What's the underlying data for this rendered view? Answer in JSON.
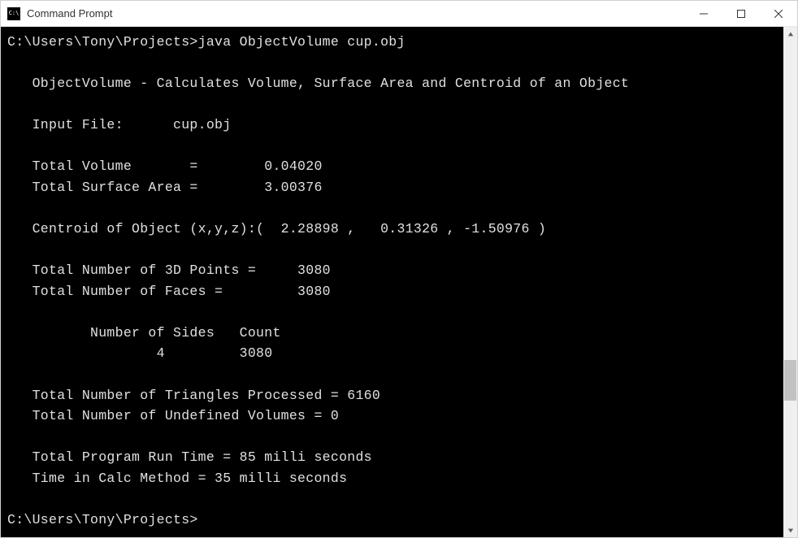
{
  "window": {
    "title": "Command Prompt"
  },
  "console": {
    "prompt1": "C:\\Users\\Tony\\Projects>java ObjectVolume cup.obj",
    "blank": "",
    "title_line": "   ObjectVolume - Calculates Volume, Surface Area and Centroid of an Object",
    "input_file": "   Input File:      cup.obj",
    "volume": "   Total Volume       =        0.04020",
    "surface": "   Total Surface Area =        3.00376",
    "centroid": "   Centroid of Object (x,y,z):(  2.28898 ,   0.31326 , -1.50976 )",
    "points": "   Total Number of 3D Points =     3080",
    "faces": "   Total Number of Faces =         3080",
    "sides_hdr": "          Number of Sides   Count",
    "sides_row": "                  4         3080",
    "triangles": "   Total Number of Triangles Processed = 6160",
    "undef": "   Total Number of Undefined Volumes = 0",
    "runtime": "   Total Program Run Time = 85 milli seconds",
    "calctime": "   Time in Calc Method = 35 milli seconds",
    "prompt2": "C:\\Users\\Tony\\Projects>"
  }
}
